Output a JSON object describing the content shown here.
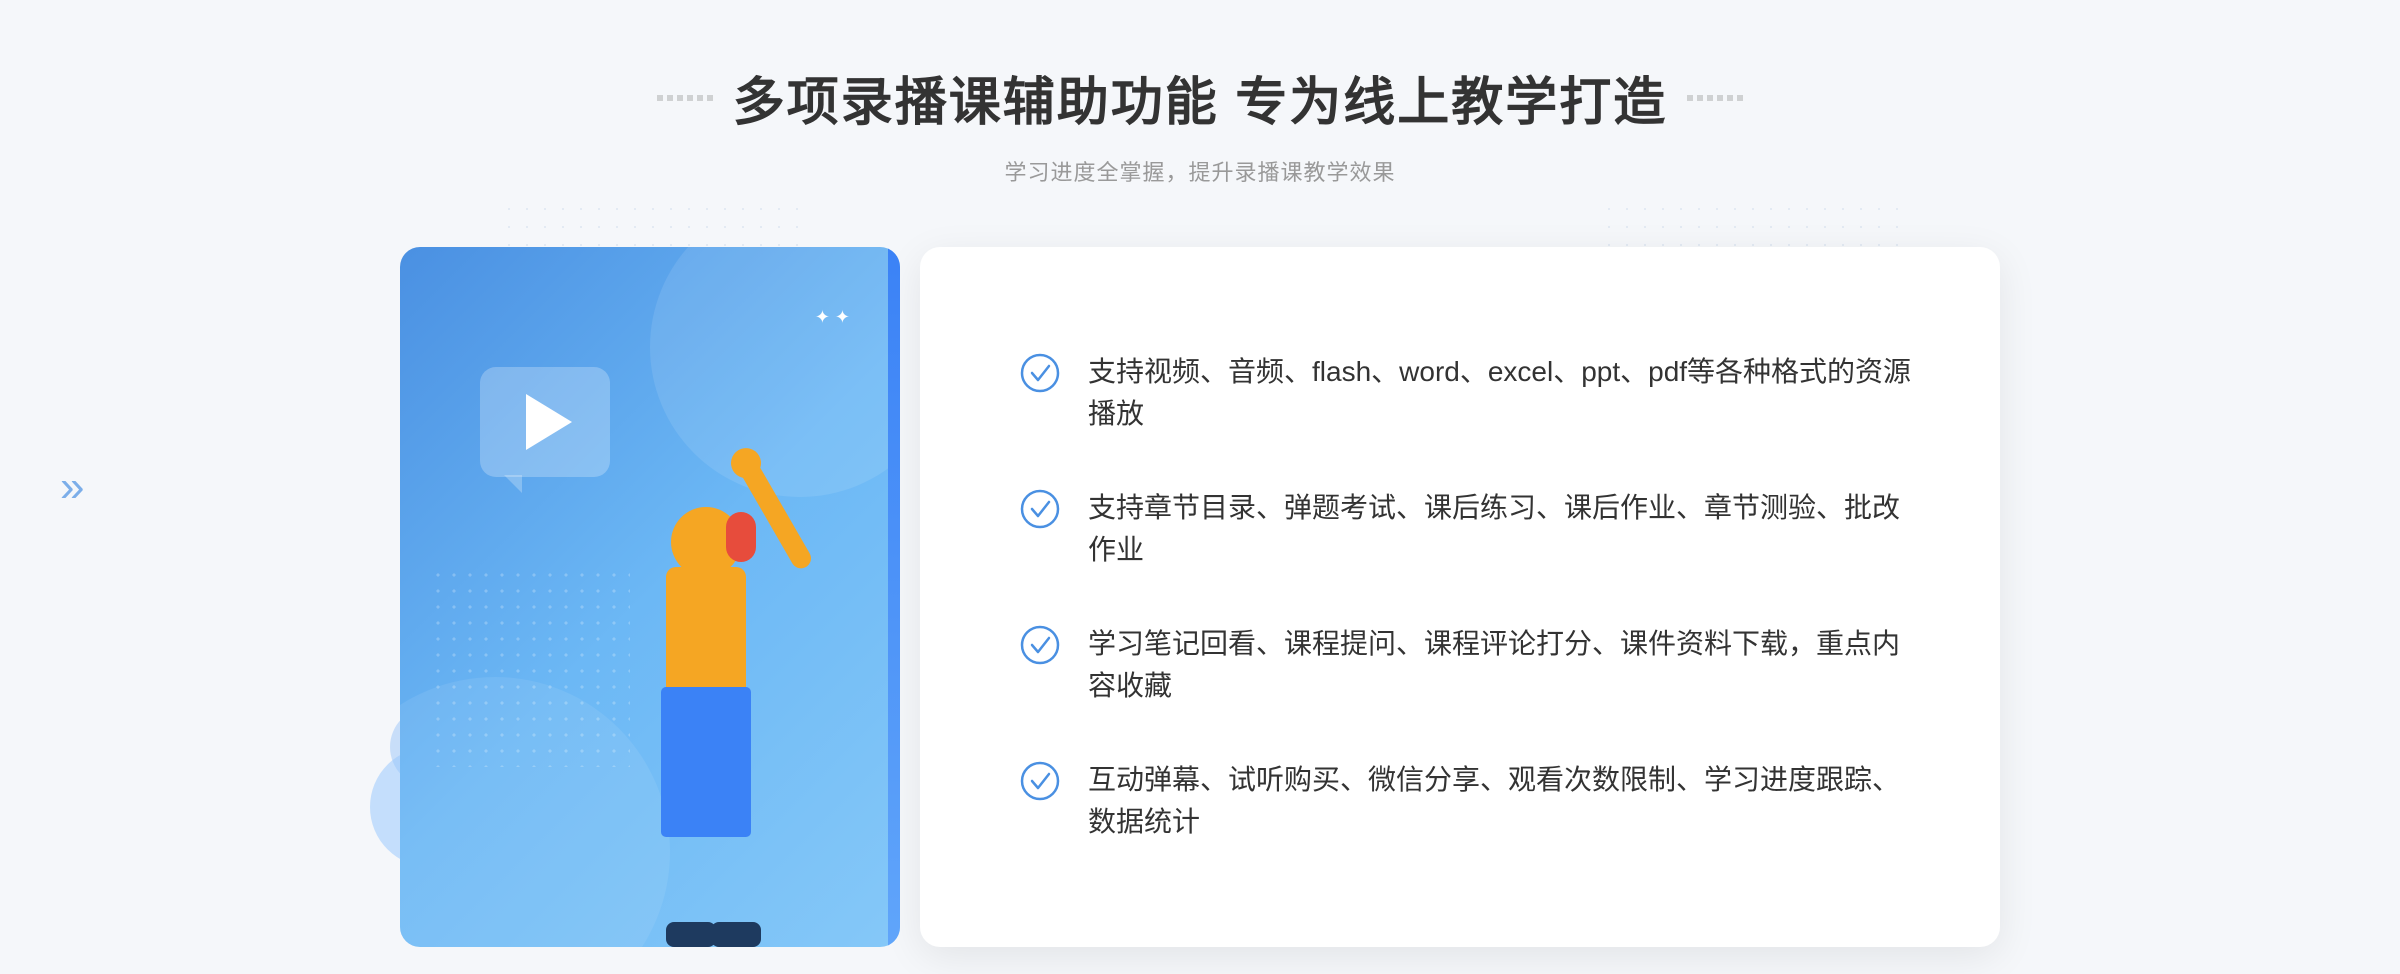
{
  "header": {
    "title": "多项录播课辅助功能 专为线上教学打造",
    "subtitle": "学习进度全掌握，提升录播课教学效果",
    "decorator_left": "⁚⁚",
    "decorator_right": "⁚⁚"
  },
  "features": [
    {
      "id": 1,
      "text": "支持视频、音频、flash、word、excel、ppt、pdf等各种格式的资源播放"
    },
    {
      "id": 2,
      "text": "支持章节目录、弹题考试、课后练习、课后作业、章节测验、批改作业"
    },
    {
      "id": 3,
      "text": "学习笔记回看、课程提问、课程评论打分、课件资料下载，重点内容收藏"
    },
    {
      "id": 4,
      "text": "互动弹幕、试听购买、微信分享、观看次数限制、学习进度跟踪、数据统计"
    }
  ],
  "colors": {
    "accent_blue": "#4a90e2",
    "light_blue": "#60a5fa",
    "title_color": "#333333",
    "subtitle_color": "#999999",
    "text_color": "#333333",
    "white": "#ffffff",
    "check_color": "#4a90e2"
  },
  "page_left_chevron": "»"
}
